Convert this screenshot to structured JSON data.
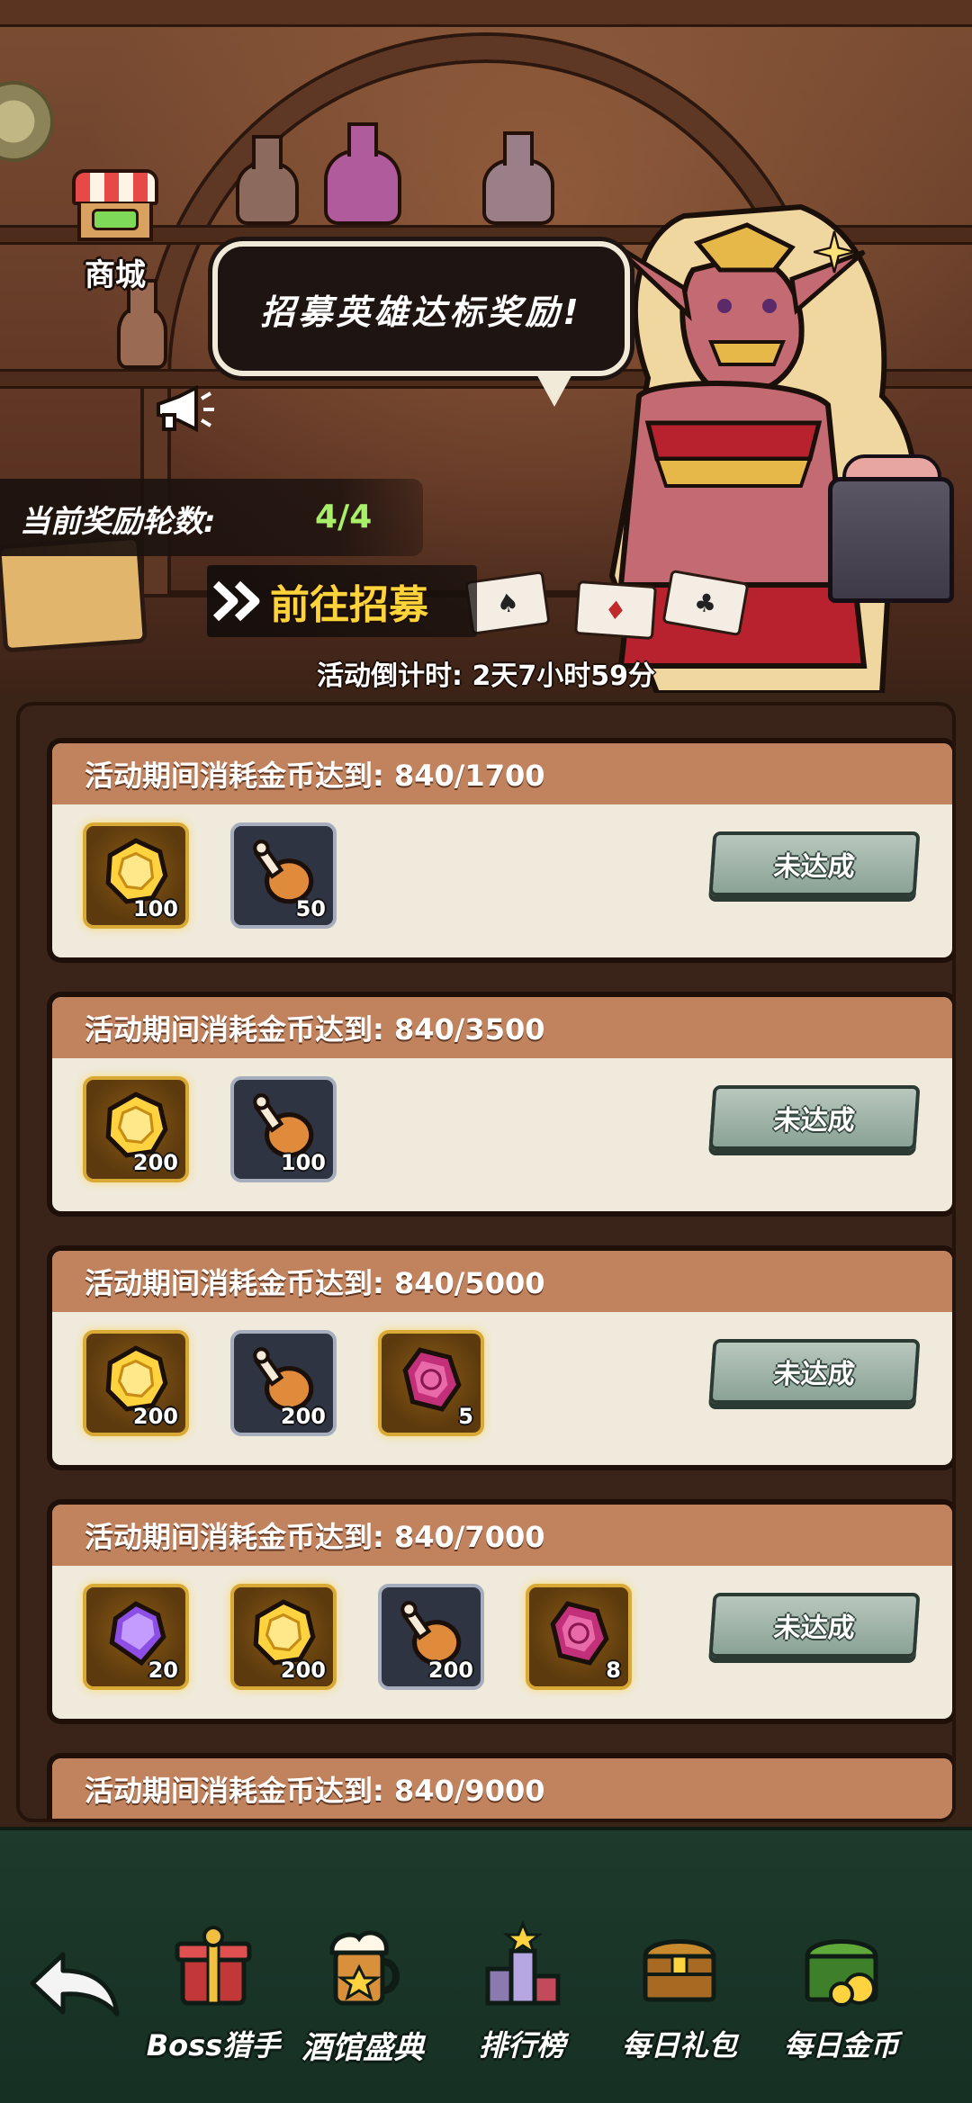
{
  "shop": {
    "label": "商城",
    "icon": "shop-stall-icon"
  },
  "banner": {
    "speech": "招募英雄达标奖励!",
    "round_label": "当前奖励轮数:",
    "round_value": "4/4",
    "recruit_button": "前往招募",
    "countdown": "活动倒计时: 2天7小时59分"
  },
  "tasks": [
    {
      "title": "活动期间消耗金币达到: 840/1700",
      "status": "未达成",
      "rewards": [
        {
          "type": "gold-coin-icon",
          "count": "100"
        },
        {
          "type": "meat-drumstick-icon",
          "count": "50"
        }
      ]
    },
    {
      "title": "活动期间消耗金币达到: 840/3500",
      "status": "未达成",
      "rewards": [
        {
          "type": "gold-coin-icon",
          "count": "200"
        },
        {
          "type": "meat-drumstick-icon",
          "count": "100"
        }
      ]
    },
    {
      "title": "活动期间消耗金币达到: 840/5000",
      "status": "未达成",
      "rewards": [
        {
          "type": "gold-coin-icon",
          "count": "200"
        },
        {
          "type": "meat-drumstick-icon",
          "count": "200"
        },
        {
          "type": "pink-gem-icon",
          "count": "5"
        }
      ]
    },
    {
      "title": "活动期间消耗金币达到: 840/7000",
      "status": "未达成",
      "rewards": [
        {
          "type": "purple-diamond-icon",
          "count": "20"
        },
        {
          "type": "gold-coin-icon",
          "count": "200"
        },
        {
          "type": "meat-drumstick-icon",
          "count": "200"
        },
        {
          "type": "pink-gem-icon",
          "count": "8"
        }
      ]
    },
    {
      "title": "活动期间消耗金币达到: 840/9000",
      "status": "",
      "rewards": []
    }
  ],
  "nav": {
    "back_icon": "back-arrow-icon",
    "items": [
      {
        "label": "Boss猎手",
        "icon": "boss-gift-icon",
        "active": false
      },
      {
        "label": "酒馆盛典",
        "icon": "beer-mug-icon",
        "active": true
      },
      {
        "label": "排行榜",
        "icon": "trophy-podium-icon",
        "active": false
      },
      {
        "label": "每日礼包",
        "icon": "treasure-chest-icon",
        "active": false
      },
      {
        "label": "每日金币",
        "icon": "gold-chest-icon",
        "active": false
      }
    ]
  },
  "colors": {
    "accent_yellow": "#ffd43a",
    "round_green": "#a9f06a",
    "task_header": "#c1825e",
    "task_body": "#efeadc",
    "status_button": "#8aa296",
    "nav_bg": "#1d3a2c"
  }
}
